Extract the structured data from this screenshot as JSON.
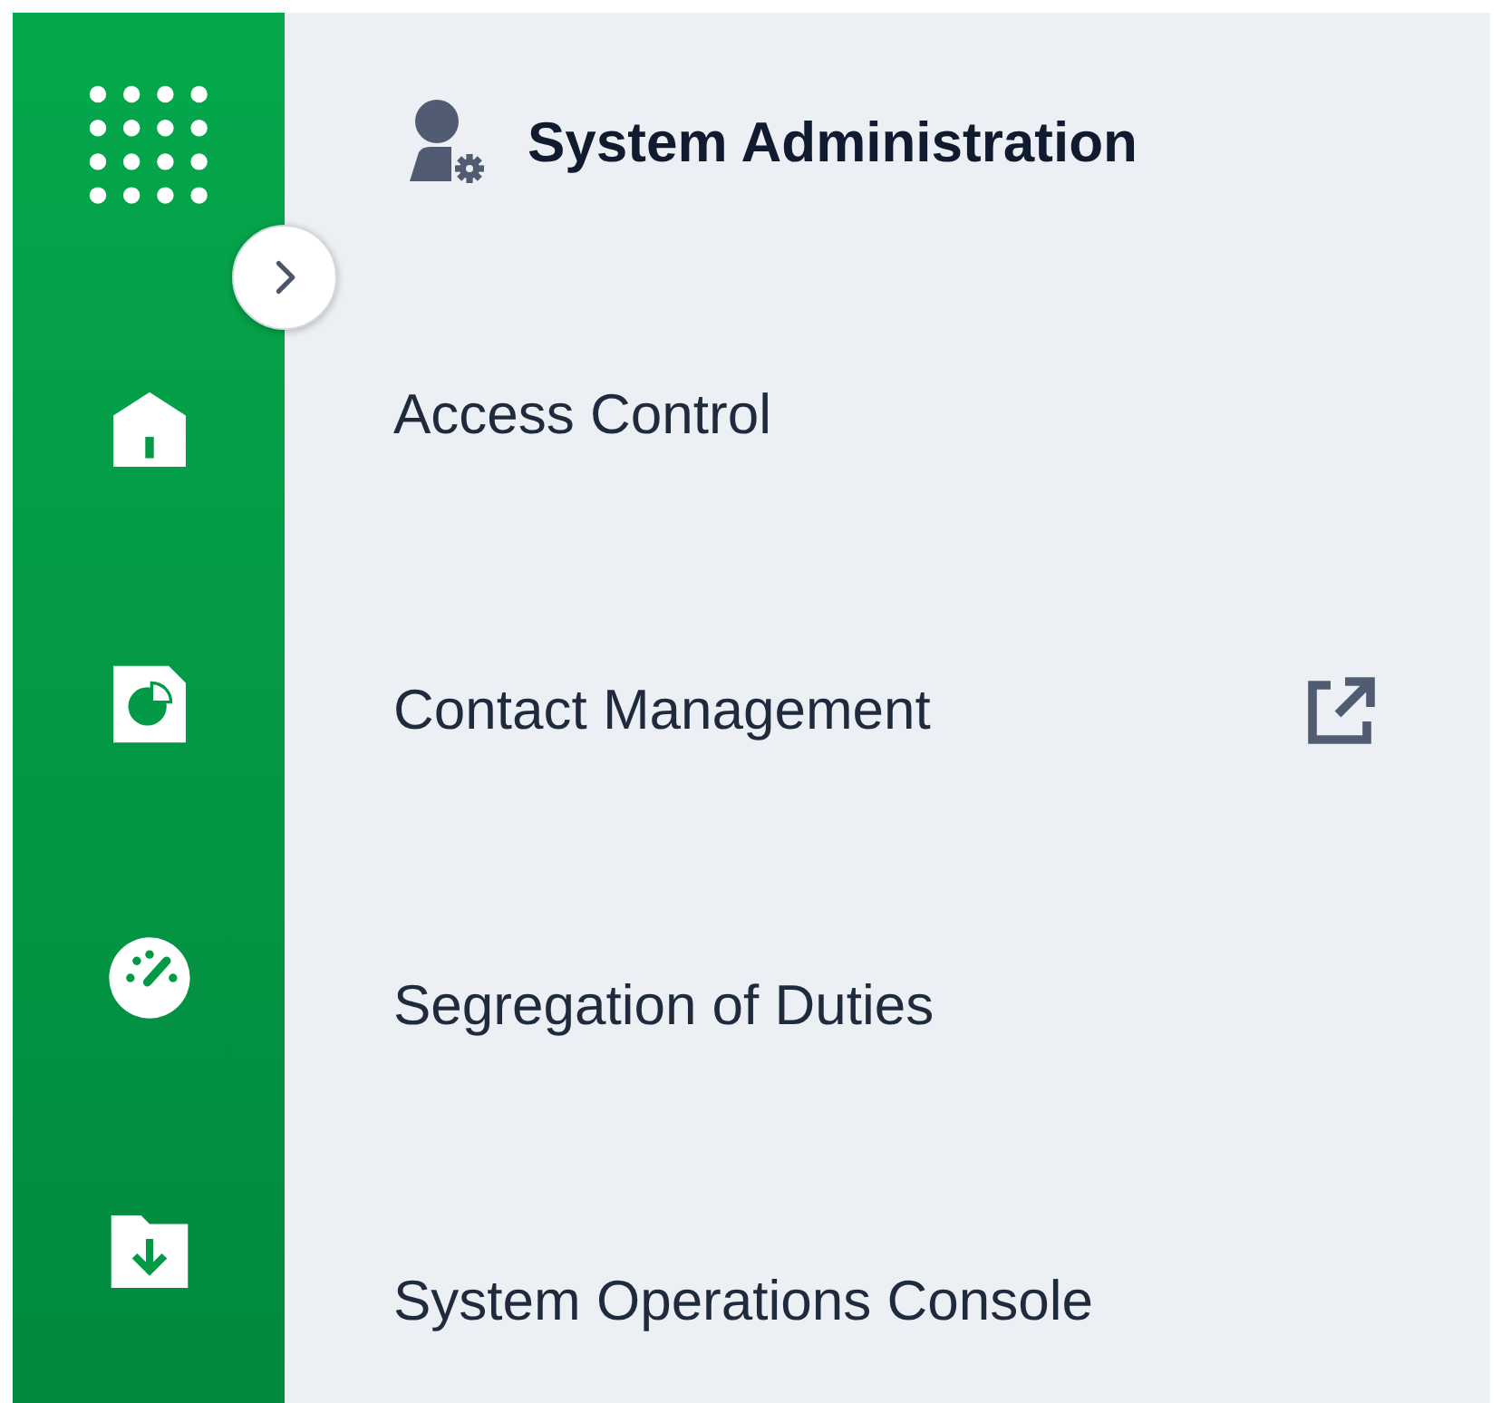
{
  "rail": {
    "items": [
      {
        "kind": "home"
      },
      {
        "kind": "report"
      },
      {
        "kind": "dashboard"
      },
      {
        "kind": "download"
      }
    ]
  },
  "panel": {
    "title": "System Administration",
    "items": [
      {
        "label": "Access Control",
        "external": false
      },
      {
        "label": "Contact Management",
        "external": true
      },
      {
        "label": "Segregation of Duties",
        "external": false
      },
      {
        "label": "System Operations Console",
        "external": false
      }
    ]
  }
}
